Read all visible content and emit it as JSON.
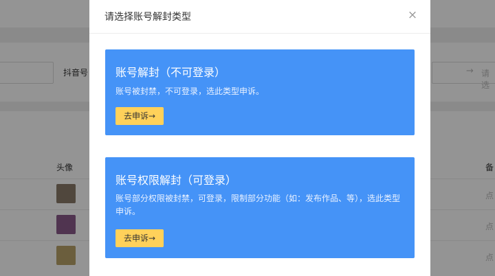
{
  "background": {
    "filter_label": "抖音号",
    "search_placeholder": "请选",
    "search_arrow": "→",
    "table_headers": {
      "avatar": "头像",
      "note": "备"
    },
    "row_note": "点",
    "rows": [
      {
        "avatar_color": "#8a7a6a",
        "note": "点"
      },
      {
        "avatar_color": "#8a5a8a",
        "note": "点"
      },
      {
        "avatar_color": "#b8a26a",
        "note": "点"
      }
    ]
  },
  "modal": {
    "title": "请选择账号解封类型",
    "close_glyph": "×",
    "options": [
      {
        "title": "账号解封（不可登录）",
        "description": "账号被封禁，不可登录，选此类型申诉。",
        "button": "去申诉→"
      },
      {
        "title": "账号权限解封（可登录）",
        "description": "账号部分权限被封禁，可登录，限制部分功能（如：发布作品、等），选此类型申诉。",
        "button": "去申诉→"
      }
    ]
  },
  "colors": {
    "card_blue": "#4593f7",
    "button_yellow": "#ffd15a",
    "overlay": "rgba(0,0,0,0.42)"
  }
}
